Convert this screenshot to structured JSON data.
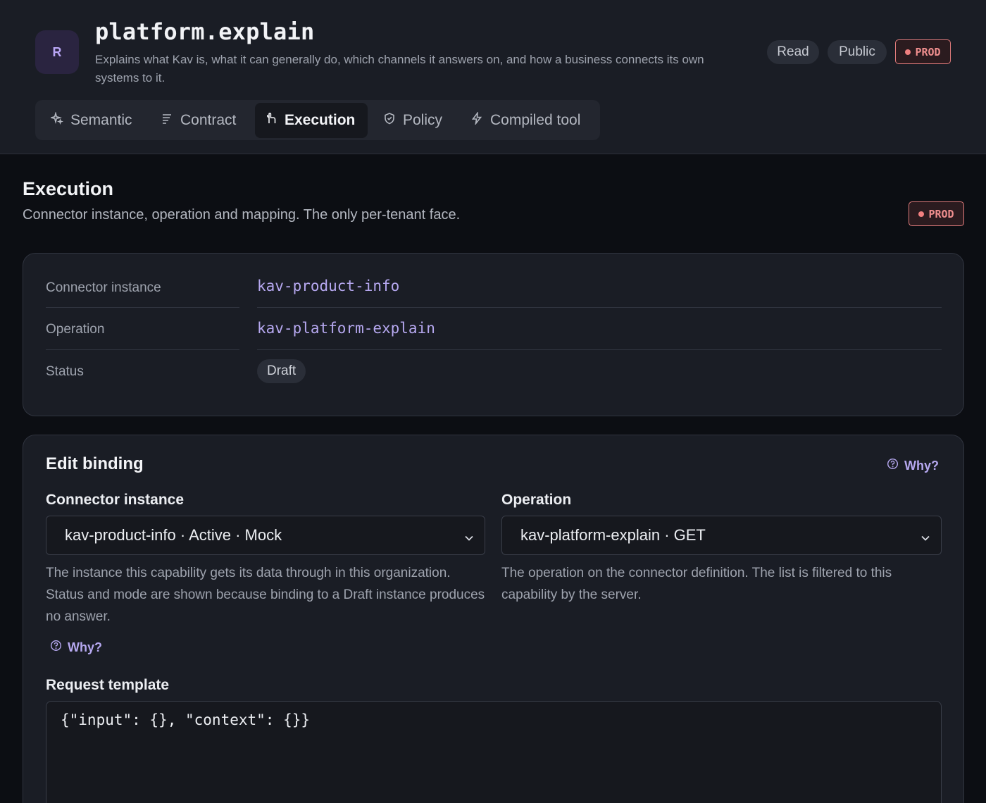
{
  "header": {
    "avatar_letter": "R",
    "title": "platform.explain",
    "description": "Explains what Kav is, what it can generally do, which channels it answers on, and how a business connects its own systems to it.",
    "badges": {
      "read": "Read",
      "public": "Public",
      "prod": "PROD"
    }
  },
  "tabs": [
    {
      "label": "Semantic",
      "icon": "sparkle-icon"
    },
    {
      "label": "Contract",
      "icon": "lines-icon"
    },
    {
      "label": "Execution",
      "icon": "hand-icon",
      "active": true
    },
    {
      "label": "Policy",
      "icon": "shield-icon"
    },
    {
      "label": "Compiled tool",
      "icon": "bolt-icon"
    }
  ],
  "section": {
    "title": "Execution",
    "subtitle": "Connector instance, operation and mapping. The only per-tenant face.",
    "badge": "PROD"
  },
  "summary": {
    "connector_label": "Connector instance",
    "connector_value": "kav-product-info",
    "operation_label": "Operation",
    "operation_value": "kav-platform-explain",
    "status_label": "Status",
    "status_value": "Draft"
  },
  "edit": {
    "title": "Edit binding",
    "why": "Why?",
    "connector_label": "Connector instance",
    "connector_selected": "kav-product-info · Active · Mock",
    "connector_help": "The instance this capability gets its data through in this organization. Status and mode are shown because binding to a Draft instance produces no answer.",
    "connector_why": "Why?",
    "operation_label": "Operation",
    "operation_selected": "kav-platform-explain · GET",
    "operation_help": "The operation on the connector definition. The list is filtered to this capability by the server.",
    "template_label": "Request template",
    "template_value": "{\"input\": {}, \"context\": {}}"
  },
  "colors": {
    "accent": "#b6a8f0",
    "prod": "#f08f8f",
    "background": "#0c0e13",
    "surface": "#1a1d25"
  }
}
